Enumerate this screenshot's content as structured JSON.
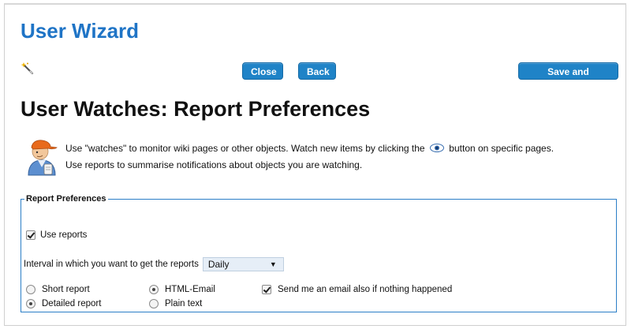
{
  "wizard": {
    "title": "User Wizard",
    "buttons": {
      "close": "Close",
      "back": "Back",
      "save_continue": "Save and Continue"
    }
  },
  "page": {
    "title": "User Watches: Report Preferences",
    "intro_line1_before": "Use \"watches\" to monitor wiki pages or other objects. Watch new items by clicking the",
    "intro_line1_after": "button on specific pages.",
    "intro_line2": "Use reports to summarise notifications about objects you are watching."
  },
  "prefs": {
    "legend": "Report Preferences",
    "use_reports": {
      "label": "Use reports",
      "checked": true
    },
    "interval": {
      "label": "Interval in which you want to get the reports",
      "value": "Daily"
    },
    "report_type": [
      {
        "label": "Short report",
        "checked": false
      },
      {
        "label": "Detailed report",
        "checked": true
      }
    ],
    "format": [
      {
        "label": "HTML-Email",
        "checked": true
      },
      {
        "label": "Plain text",
        "checked": false
      }
    ],
    "always_email": {
      "label": "Send me an email also if nothing happened",
      "checked": true
    }
  },
  "colors": {
    "title_blue": "#1f74c6",
    "button_blue": "#1f83c7",
    "fieldset_border": "#2b7ec7"
  },
  "icons": {
    "wand": "wand-icon",
    "user": "user-icon",
    "eye": "eye-icon"
  }
}
